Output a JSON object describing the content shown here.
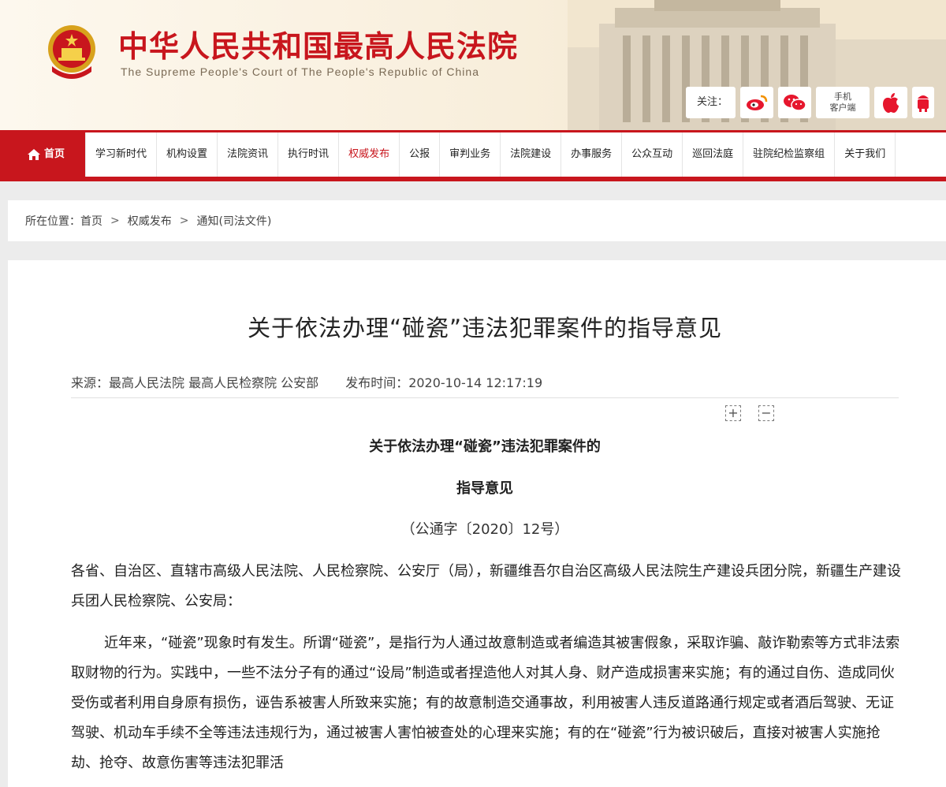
{
  "header": {
    "title": "中华人民共和国最高人民法院",
    "subtitle": "The Supreme People's Court of The People's Republic of China",
    "follow_label": "关注：",
    "mobile_line1": "手机",
    "mobile_line2": "客户端",
    "social_icons": [
      "weibo-icon",
      "wechat-icon",
      "mobile-client-icon",
      "apple-icon",
      "android-icon"
    ]
  },
  "nav": {
    "items": [
      "首页",
      "学习新时代",
      "机构设置",
      "法院资讯",
      "执行时讯",
      "权威发布",
      "公报",
      "审判业务",
      "法院建设",
      "办事服务",
      "公众互动",
      "巡回法庭",
      "驻院纪检监察组",
      "关于我们"
    ],
    "active_index": 5
  },
  "breadcrumb": {
    "label": "所在位置：",
    "items": [
      "首页",
      "权威发布",
      "通知(司法文件)"
    ],
    "separator": ">"
  },
  "article": {
    "title": "关于依法办理“碰瓷”违法犯罪案件的指导意见",
    "source": "来源：最高人民法院 最高人民检察院 公安部",
    "publish_time": "发布时间：2020-10-14 12:17:19",
    "zoom_in": "+",
    "zoom_out": "−",
    "doc_heading1": "关于依法办理“碰瓷”违法犯罪案件的",
    "doc_heading2": "指导意见",
    "doc_number": "（公通字〔2020〕12号）",
    "paragraph1": "各省、自治区、直辖市高级人民法院、人民检察院、公安厅（局），新疆维吾尔自治区高级人民法院生产建设兵团分院，新疆生产建设兵团人民检察院、公安局：",
    "paragraph2": "近年来，“碰瓷”现象时有发生。所谓“碰瓷”，是指行为人通过故意制造或者编造其被害假象，采取诈骗、敲诈勒索等方式非法索取财物的行为。实践中，一些不法分子有的通过“设局”制造或者捏造他人对其人身、财产造成损害来实施；有的通过自伤、造成同伙受伤或者利用自身原有损伤，诬告系被害人所致来实施；有的故意制造交通事故，利用被害人违反道路通行规定或者酒后驾驶、无证驾驶、机动车手续不全等违法违规行为，通过被害人害怕被查处的心理来实施；有的在“碰瓷”行为被识破后，直接对被害人实施抢劫、抢夺、故意伤害等违法犯罪活"
  },
  "colors": {
    "brand_red": "#c8161d",
    "nav_active_text": "#c8161d"
  }
}
